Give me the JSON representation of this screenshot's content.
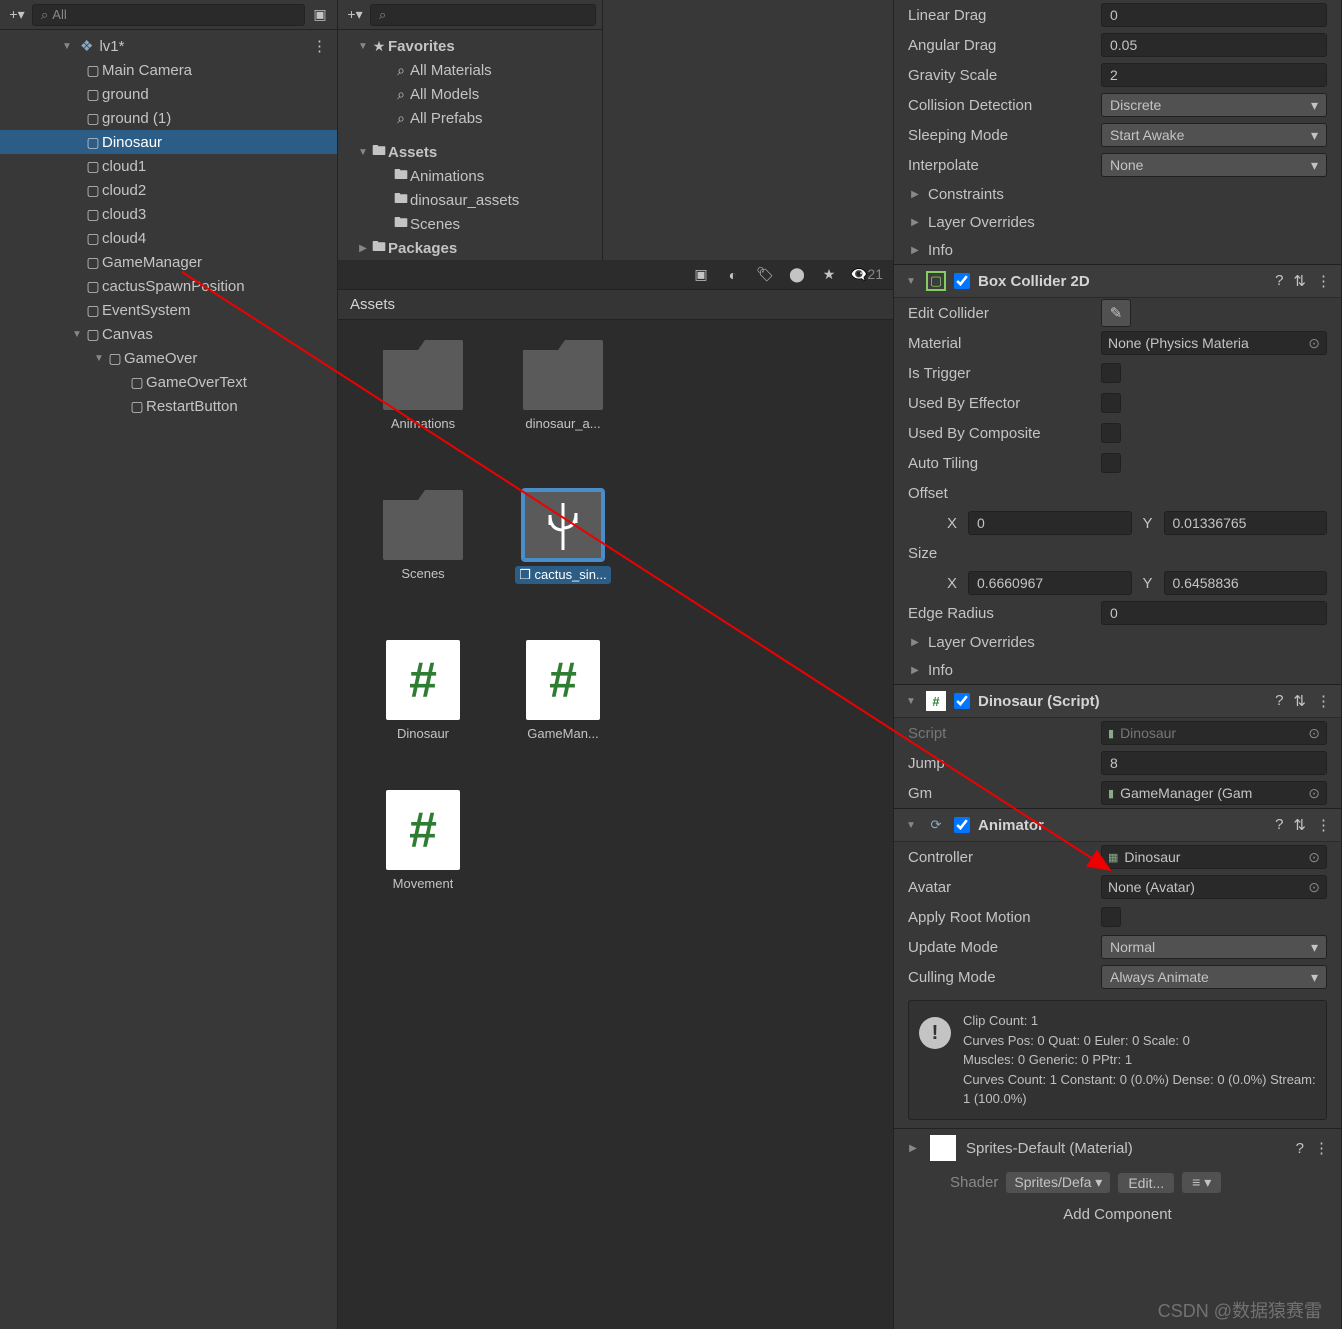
{
  "hierarchy": {
    "search_placeholder": "All",
    "scene": "lv1*",
    "items": [
      {
        "label": "Main Camera",
        "depth": 1
      },
      {
        "label": "ground",
        "depth": 1
      },
      {
        "label": "ground (1)",
        "depth": 1
      },
      {
        "label": "Dinosaur",
        "depth": 1,
        "selected": true
      },
      {
        "label": "cloud1",
        "depth": 1
      },
      {
        "label": "cloud2",
        "depth": 1
      },
      {
        "label": "cloud3",
        "depth": 1
      },
      {
        "label": "cloud4",
        "depth": 1
      },
      {
        "label": "GameManager",
        "depth": 1
      },
      {
        "label": "cactusSpawnPosition",
        "depth": 1
      },
      {
        "label": "EventSystem",
        "depth": 1
      },
      {
        "label": "Canvas",
        "depth": 1,
        "arrow": "▼"
      },
      {
        "label": "GameOver",
        "depth": 2,
        "arrow": "▼"
      },
      {
        "label": "GameOverText",
        "depth": 3
      },
      {
        "label": "RestartButton",
        "depth": 3
      }
    ]
  },
  "project": {
    "hidden_count": "21",
    "tree": {
      "favorites_label": "Favorites",
      "favorites": [
        "All Materials",
        "All Models",
        "All Prefabs"
      ],
      "assets_label": "Assets",
      "assets": [
        "Animations",
        "dinosaur_assets",
        "Scenes"
      ],
      "packages_label": "Packages"
    },
    "assets_header": "Assets",
    "grid": [
      {
        "label": "Animations",
        "type": "folder"
      },
      {
        "label": "dinosaur_a...",
        "type": "folder"
      },
      {
        "label": "Scenes",
        "type": "folder"
      },
      {
        "label": "cactus_sin...",
        "type": "prefab",
        "selected": true
      },
      {
        "label": "Dinosaur",
        "type": "script"
      },
      {
        "label": "GameMan...",
        "type": "script"
      },
      {
        "label": "Movement",
        "type": "script"
      }
    ]
  },
  "inspector": {
    "rb": {
      "linear_drag_label": "Linear Drag",
      "linear_drag": "0",
      "angular_drag_label": "Angular Drag",
      "angular_drag": "0.05",
      "gravity_scale_label": "Gravity Scale",
      "gravity_scale": "2",
      "collision_label": "Collision Detection",
      "collision": "Discrete",
      "sleeping_label": "Sleeping Mode",
      "sleeping": "Start Awake",
      "interpolate_label": "Interpolate",
      "interpolate": "None",
      "constraints_label": "Constraints",
      "layer_overrides_label": "Layer Overrides",
      "info_label": "Info"
    },
    "box": {
      "title": "Box Collider 2D",
      "edit_label": "Edit Collider",
      "material_label": "Material",
      "material": "None (Physics Materia",
      "is_trigger_label": "Is Trigger",
      "used_effector_label": "Used By Effector",
      "used_composite_label": "Used By Composite",
      "auto_tiling_label": "Auto Tiling",
      "offset_label": "Offset",
      "offset_x": "0",
      "offset_y": "0.01336765",
      "size_label": "Size",
      "size_x": "0.6660967",
      "size_y": "0.6458836",
      "edge_radius_label": "Edge Radius",
      "edge_radius": "0",
      "layer_overrides_label": "Layer Overrides",
      "info_label": "Info"
    },
    "script": {
      "title": "Dinosaur (Script)",
      "script_label": "Script",
      "script_val": "Dinosaur",
      "jump_label": "Jump",
      "jump_val": "8",
      "gm_label": "Gm",
      "gm_val": "GameManager (Gam"
    },
    "animator": {
      "title": "Animator",
      "controller_label": "Controller",
      "controller": "Dinosaur",
      "avatar_label": "Avatar",
      "avatar": "None (Avatar)",
      "root_motion_label": "Apply Root Motion",
      "update_mode_label": "Update Mode",
      "update_mode": "Normal",
      "culling_label": "Culling Mode",
      "culling": "Always Animate",
      "info": "Clip Count: 1\nCurves Pos: 0 Quat: 0 Euler: 0 Scale: 0\nMuscles: 0 Generic: 0 PPtr: 1\nCurves Count: 1 Constant: 0 (0.0%) Dense: 0 (0.0%) Stream: 1 (100.0%)"
    },
    "material": {
      "title": "Sprites-Default (Material)",
      "shader_label": "Shader",
      "shader": "Sprites/Defa",
      "edit": "Edit..."
    },
    "add_component": "Add Component"
  },
  "watermark": "CSDN @数据猿赛雷"
}
